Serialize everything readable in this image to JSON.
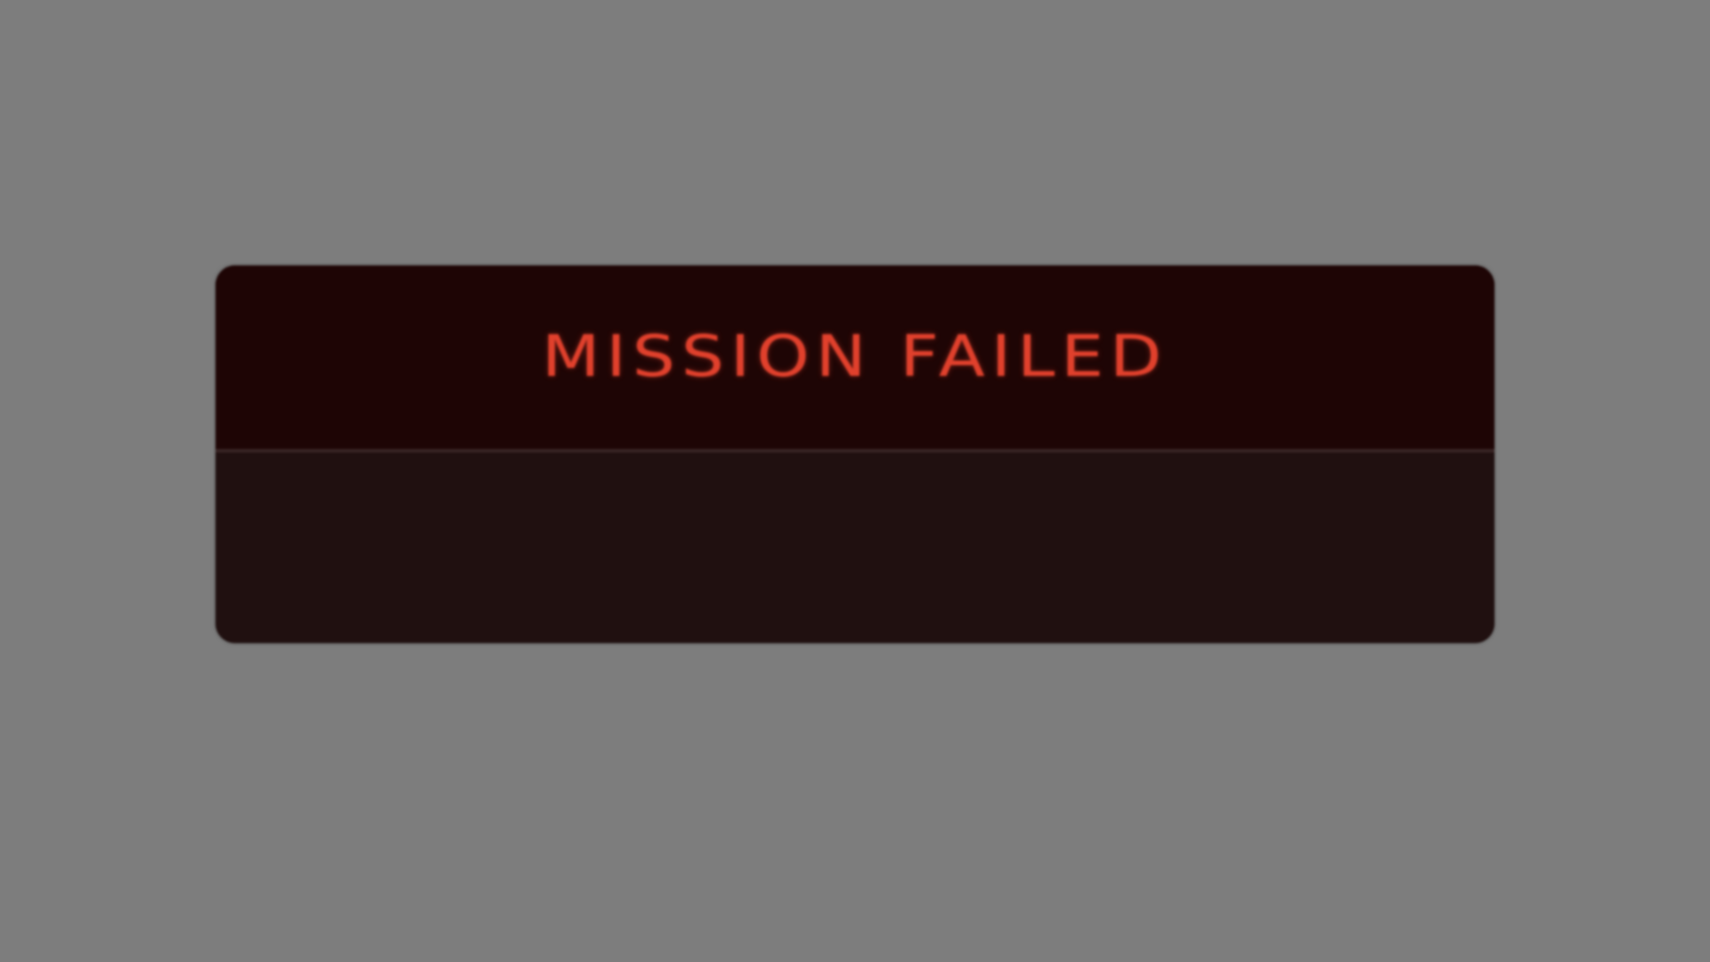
{
  "dialog": {
    "title": "MISSION FAILED",
    "title_color": "#e0402c",
    "header_background": "#1e0505",
    "body_background": "#201010"
  },
  "screen": {
    "overlay_color": "#7d7d7d"
  }
}
